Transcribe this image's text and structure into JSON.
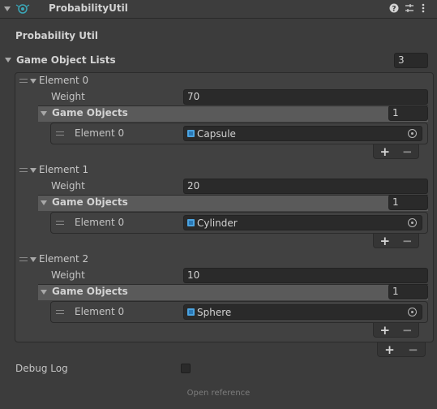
{
  "header": {
    "title": "ProbabilityUtil"
  },
  "component": {
    "script_label": "Probability Util",
    "list_label": "Game Object Lists",
    "list_size": "3",
    "elements": [
      {
        "label": "Element 0",
        "weight_label": "Weight",
        "weight": "70",
        "objects_label": "Game Objects",
        "objects_size": "1",
        "item_label": "Element 0",
        "item_value": "Capsule"
      },
      {
        "label": "Element 1",
        "weight_label": "Weight",
        "weight": "20",
        "objects_label": "Game Objects",
        "objects_size": "1",
        "item_label": "Element 0",
        "item_value": "Cylinder"
      },
      {
        "label": "Element 2",
        "weight_label": "Weight",
        "weight": "10",
        "objects_label": "Game Objects",
        "objects_size": "1",
        "item_label": "Element 0",
        "item_value": "Sphere"
      }
    ],
    "plus": "+",
    "minus": "−",
    "debug_label": "Debug Log",
    "debug_value": false,
    "footer_link": "Open reference"
  },
  "icons": {
    "component": "script-icon",
    "help": "help-icon",
    "settings": "preset-icon",
    "menu": "context-menu-icon"
  },
  "colors": {
    "background": "#3c3c3c",
    "field": "#2a2a2a",
    "text": "#c4c4c4",
    "object_icon": "#4aa3e0"
  }
}
